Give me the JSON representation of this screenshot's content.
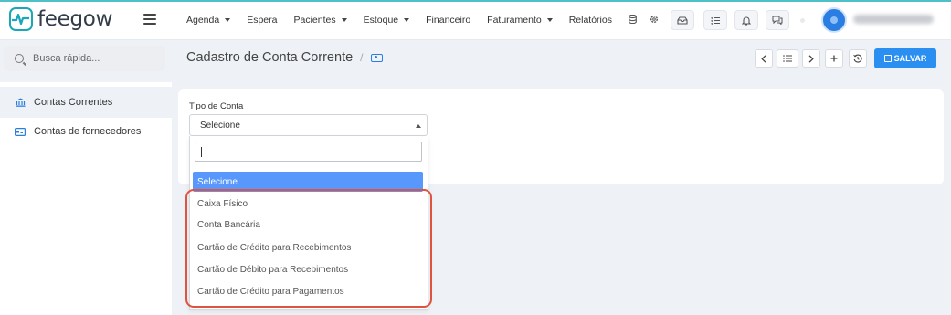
{
  "app": {
    "logo_text": "feegow"
  },
  "nav": {
    "items": [
      {
        "label": "Agenda",
        "caret": true
      },
      {
        "label": "Espera",
        "caret": false
      },
      {
        "label": "Pacientes",
        "caret": true
      },
      {
        "label": "Estoque",
        "caret": true
      },
      {
        "label": "Financeiro",
        "caret": false
      },
      {
        "label": "Faturamento",
        "caret": true
      },
      {
        "label": "Relatórios",
        "caret": false
      }
    ]
  },
  "sidebar": {
    "search_placeholder": "Busca rápida...",
    "items": [
      {
        "label": "Contas Correntes",
        "icon": "bank-icon",
        "active": true
      },
      {
        "label": "Contas de fornecedores",
        "icon": "card-icon",
        "active": false
      }
    ]
  },
  "header": {
    "title": "Cadastro de Conta Corrente",
    "separator": "/",
    "save_label": "SALVAR"
  },
  "form": {
    "tipo_label": "Tipo de Conta",
    "tipo_value": "Selecione"
  },
  "dropdown": {
    "search_value": "",
    "options": [
      "Selecione",
      "Caixa Físico",
      "Conta Bancária",
      "Cartão de Crédito para Recebimentos",
      "Cartão de Débito para Recebimentos",
      "Cartão de Crédito para Pagamentos"
    ],
    "selected_index": 0
  },
  "colors": {
    "accent": "#2a8ff0",
    "selected_option": "#5897fb",
    "highlight": "#e0533f",
    "logo": "#1aa7b8"
  }
}
